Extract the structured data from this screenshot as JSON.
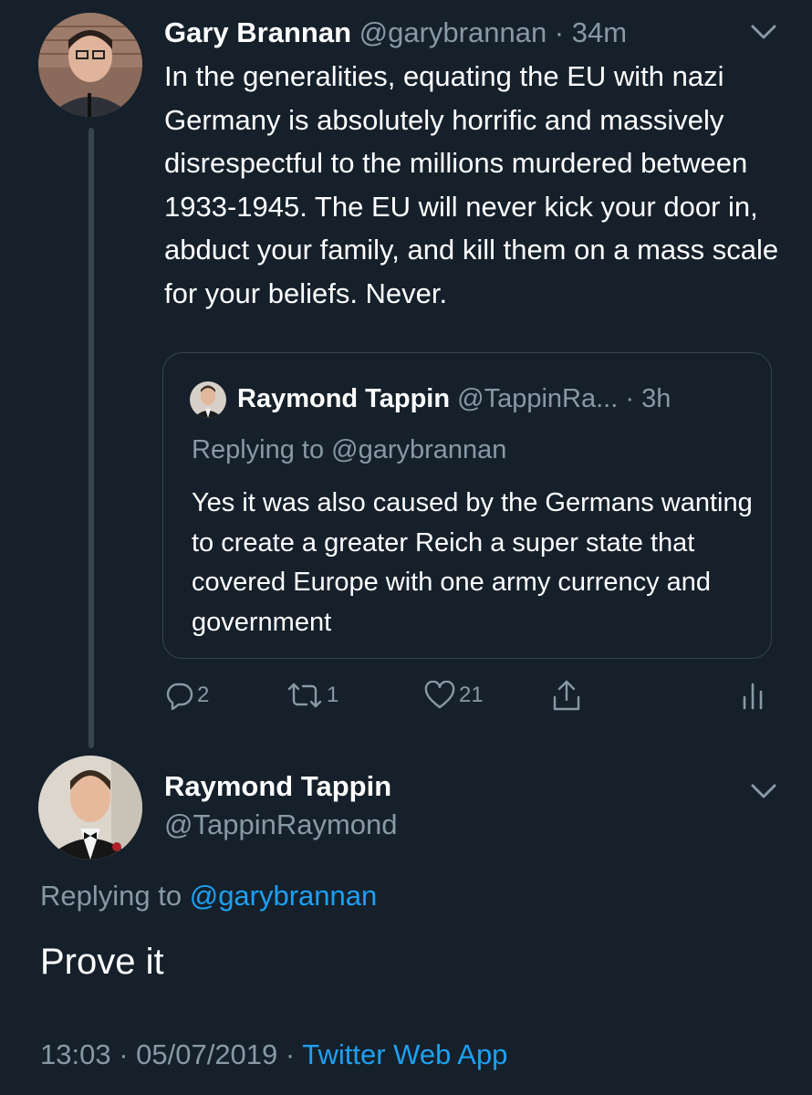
{
  "colors": {
    "background": "#15202b",
    "primary_text": "#ffffff",
    "secondary_text": "#8899a6",
    "link": "#1da1f2",
    "border": "#38444d"
  },
  "tweet": {
    "avatar_icon": "user-avatar",
    "name": "Gary Brannan",
    "handle": "@garybrannan",
    "separator": " · ",
    "time": "34m",
    "menu_icon": "chevron-down-icon",
    "text": "In the generalities, equating the EU with nazi Germany is absolutely horrific and massively disrespectful to the millions murdered between 1933-1945. The EU will never kick your door in, abduct your family, and kill them on a mass scale for your beliefs. Never.",
    "quote": {
      "avatar_icon": "user-avatar",
      "name": "Raymond Tappin",
      "handle": "@TappinRa...",
      "separator": " · ",
      "time": "3h",
      "replying_to": "Replying to @garybrannan",
      "text": "Yes it was also caused by the Germans wanting to create a greater Reich a super state that covered Europe with one army currency and government"
    },
    "actions": {
      "reply_icon": "reply-icon",
      "reply_count": "2",
      "retweet_icon": "retweet-icon",
      "retweet_count": "1",
      "like_icon": "heart-icon",
      "like_count": "21",
      "share_icon": "share-icon",
      "analytics_icon": "analytics-icon"
    }
  },
  "reply_tweet": {
    "avatar_icon": "user-avatar",
    "name": "Raymond Tappin",
    "handle": "@TappinRaymond",
    "menu_icon": "chevron-down-icon",
    "replying_prefix": "Replying to ",
    "replying_handle": "@garybrannan",
    "text": "Prove it",
    "timestamp": "13:03 · 05/07/2019",
    "meta_separator": " · ",
    "source": "Twitter Web App"
  }
}
